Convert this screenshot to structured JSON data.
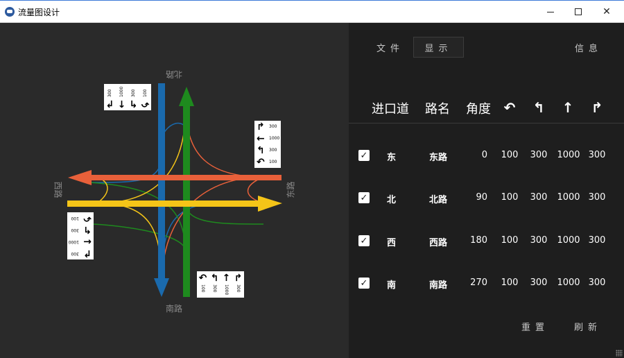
{
  "window": {
    "title": "流量图设计",
    "controls": [
      "minimize",
      "maximize",
      "close"
    ]
  },
  "colors": {
    "east": "#e8603a",
    "north": "#1e8a1e",
    "west": "#f5c518",
    "south": "#1a6aad",
    "panel_bg": "#1e1e1e",
    "canvas_bg": "#2a2a2a"
  },
  "diagram": {
    "road_labels": {
      "north": "北路",
      "south": "南路",
      "west": "西路",
      "east": "东路"
    },
    "tags": {
      "north": {
        "values": [
          "300",
          "1000",
          "300",
          "100"
        ]
      },
      "south": {
        "values": [
          "100",
          "300",
          "1000",
          "300"
        ]
      },
      "east": {
        "values": [
          "300",
          "1000",
          "300",
          "100"
        ]
      },
      "west": {
        "values": [
          "100",
          "300",
          "1000",
          "300"
        ]
      }
    },
    "arrow_icons": [
      "right-turn",
      "straight",
      "left-turn",
      "u-turn"
    ]
  },
  "menu": {
    "file": "文件",
    "display": "显示",
    "info": "信息"
  },
  "table": {
    "headers": {
      "entry": "进口道",
      "road": "路名",
      "angle": "角度"
    },
    "header_icons": [
      "u-turn-icon",
      "left-turn-icon",
      "straight-icon",
      "right-turn-icon"
    ],
    "rows": [
      {
        "checked": true,
        "entry": "东",
        "road": "东路",
        "angle": "0",
        "u": "100",
        "l": "300",
        "s": "1000",
        "r": "300"
      },
      {
        "checked": true,
        "entry": "北",
        "road": "北路",
        "angle": "90",
        "u": "100",
        "l": "300",
        "s": "1000",
        "r": "300"
      },
      {
        "checked": true,
        "entry": "西",
        "road": "西路",
        "angle": "180",
        "u": "100",
        "l": "300",
        "s": "1000",
        "r": "300"
      },
      {
        "checked": true,
        "entry": "南",
        "road": "南路",
        "angle": "270",
        "u": "100",
        "l": "300",
        "s": "1000",
        "r": "300"
      }
    ]
  },
  "buttons": {
    "reset": "重置",
    "refresh": "刷新"
  }
}
